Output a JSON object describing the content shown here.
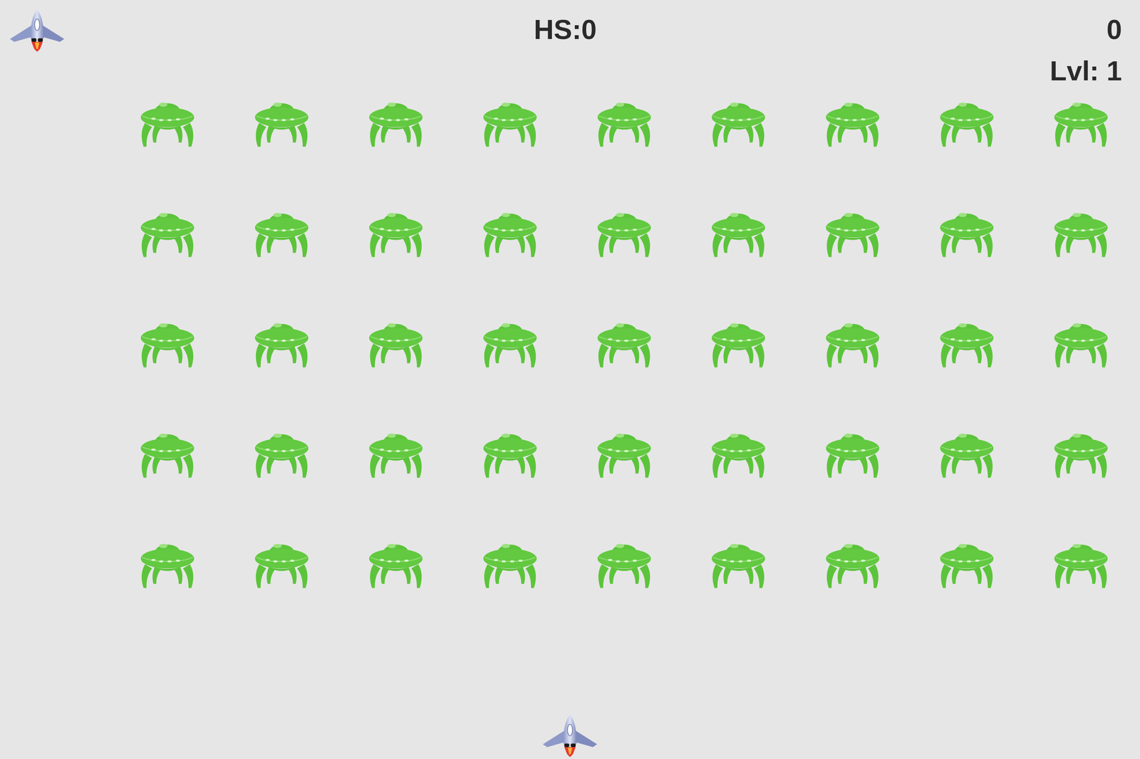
{
  "hud": {
    "high_score": "HS:0",
    "score": "0",
    "level": "Lvl: 1"
  },
  "lives": 1,
  "aliens": [
    [
      true,
      true,
      true,
      true,
      true,
      true,
      true,
      true,
      true
    ],
    [
      true,
      true,
      true,
      true,
      true,
      true,
      true,
      true,
      true
    ],
    [
      true,
      true,
      true,
      true,
      true,
      true,
      true,
      true,
      true
    ],
    [
      true,
      true,
      true,
      true,
      true,
      true,
      true,
      true,
      true
    ],
    [
      true,
      true,
      true,
      true,
      true,
      true,
      true,
      true,
      true
    ]
  ]
}
